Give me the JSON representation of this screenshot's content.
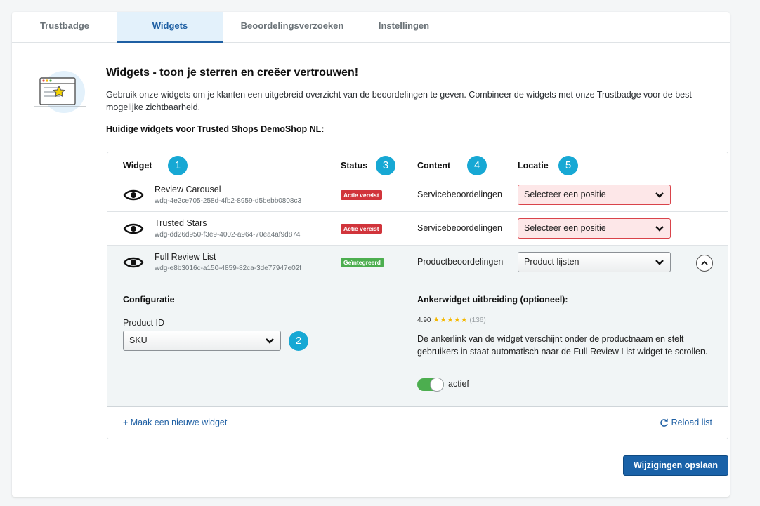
{
  "tabs": [
    "Trustbadge",
    "Widgets",
    "Beoordelingsverzoeken",
    "Instellingen"
  ],
  "active_tab": "Widgets",
  "header": {
    "title": "Widgets - toon je sterren en creëer vertrouwen!",
    "description": "Gebruik onze widgets om je klanten een uitgebreid overzicht van de beoordelingen te geven. Combineer de widgets met onze Trustbadge voor de best mogelijke zichtbaarheid.",
    "subheading": "Huidige widgets voor Trusted Shops DemoShop NL:"
  },
  "table": {
    "columns": [
      "Widget",
      "Status",
      "Content",
      "Locatie"
    ],
    "markers": [
      "1",
      "2",
      "3",
      "4",
      "5"
    ],
    "rows": [
      {
        "name": "Review Carousel",
        "id": "wdg-4e2ce705-258d-4fb2-8959-d5bebb0808c3",
        "status": "Actie vereist",
        "content": "Servicebeoordelingen",
        "location": "Selecteer een positie"
      },
      {
        "name": "Trusted Stars",
        "id": "wdg-dd26d950-f3e9-4002-a964-70ea4af9d874",
        "status": "Actie vereist",
        "content": "Servicebeoordelingen",
        "location": "Selecteer een positie"
      },
      {
        "name": "Full Review List",
        "id": "wdg-e8b3016c-a150-4859-82ca-3de77947e02f",
        "status": "Geïntegreerd",
        "content": "Productbeoordelingen",
        "location": "Product lijsten"
      }
    ],
    "expanded": {
      "config_title": "Configuratie",
      "product_id_label": "Product ID",
      "product_id_value": "SKU",
      "anchor_title": "Ankerwidget uitbreiding (optioneel):",
      "rating_value": "4.90",
      "rating_stars": "★★★★★",
      "rating_count": "(136)",
      "anchor_description": "De ankerlink van de widget verschijnt onder de productnaam en stelt gebruikers in staat automatisch naar de Full Review List widget te scrollen.",
      "toggle_label": "actief",
      "toggle_on": true
    },
    "footer": {
      "new_widget": "+ Maak een nieuwe widget",
      "reload": "Reload list"
    }
  },
  "save_button": "Wijzigingen opslaan",
  "colors": {
    "primary": "#1a62a8",
    "marker": "#17a8d4",
    "error_badge": "#d1343b",
    "success_badge": "#4cae4f"
  }
}
